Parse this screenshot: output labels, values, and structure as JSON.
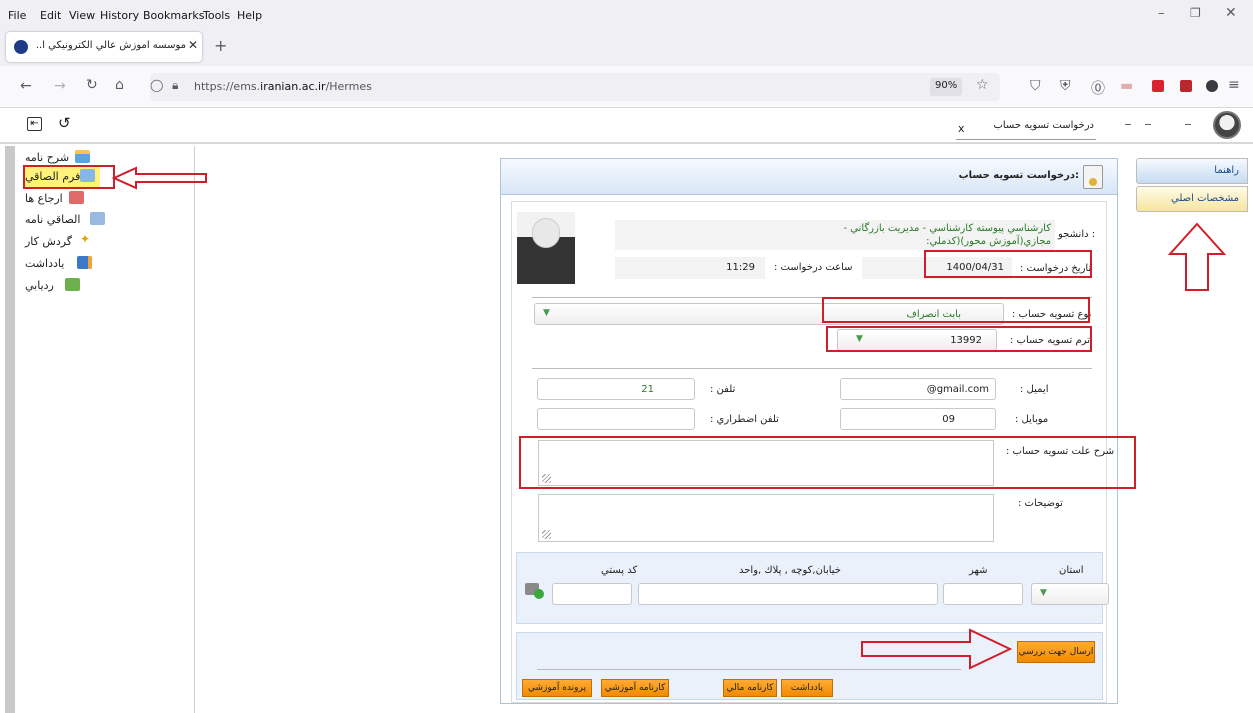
{
  "menu": [
    "File",
    "Edit",
    "View",
    "History",
    "Bookmarks",
    "Tools",
    "Help"
  ],
  "tab": {
    "title": "موسسه آموزش عالي الكترونيكي ا..."
  },
  "address": {
    "url_prefix": "https://ems.",
    "url_domain": "iranian.ac.ir",
    "url_path": "/Hermes",
    "zoom": "90%"
  },
  "app_tab": {
    "title": "درخواست تسويه حساب"
  },
  "left_nav": [
    "شرح نامه",
    "فرم الصاقي",
    "ارجاع ها",
    "الصاقي نامه",
    "گردش كار",
    "يادداشت",
    "رديابي"
  ],
  "right_tabs": [
    "راهنما",
    "مشخصات اصلي"
  ],
  "panel": {
    "title": ":درخواست تسويه حساب",
    "student_label": "دانشجو :",
    "student_line1": "كارشناسي پيوسته كارشناسي - مديريت بازرگاني -",
    "student_line2": "مجازي(آموزش محور)(كدملي:",
    "request_date_label": "تاريخ درخواست :",
    "request_date": "1400/04/31",
    "request_time_label": "ساعت درخواست :",
    "request_time": "11:29",
    "settle_type_label": "نوع تسويه حساب :",
    "settle_type": "بابت انصراف",
    "settle_term_label": "ترم تسويه حساب :",
    "settle_term": "13992",
    "email_label": "ايميل :",
    "email": "@gmail.com",
    "phone_label": "تلفن :",
    "phone": "21",
    "mobile_label": "موبايل :",
    "mobile": "09",
    "emergency_phone_label": "تلفن اضطراري :",
    "reason_label": "شرح علت تسويه حساب :",
    "notes_label": "توضيحات :",
    "province_label": "استان",
    "city_label": "شهر",
    "street_label": "خيابان,كوچه , پلاك ,واحد",
    "postal_label": "كد پستي",
    "submit_label": "ارسال جهت بررسي",
    "bottom_buttons": [
      "يادداشت",
      "كارنامه مالي",
      "كارنامه آموزشي",
      "پرونده آموزشي"
    ]
  },
  "colors": {
    "annotation_red": "#d01f2a",
    "highlight_yellow": "#fff27a",
    "button_orange": "#f5941d",
    "header_blue": "#d8e6f6"
  }
}
